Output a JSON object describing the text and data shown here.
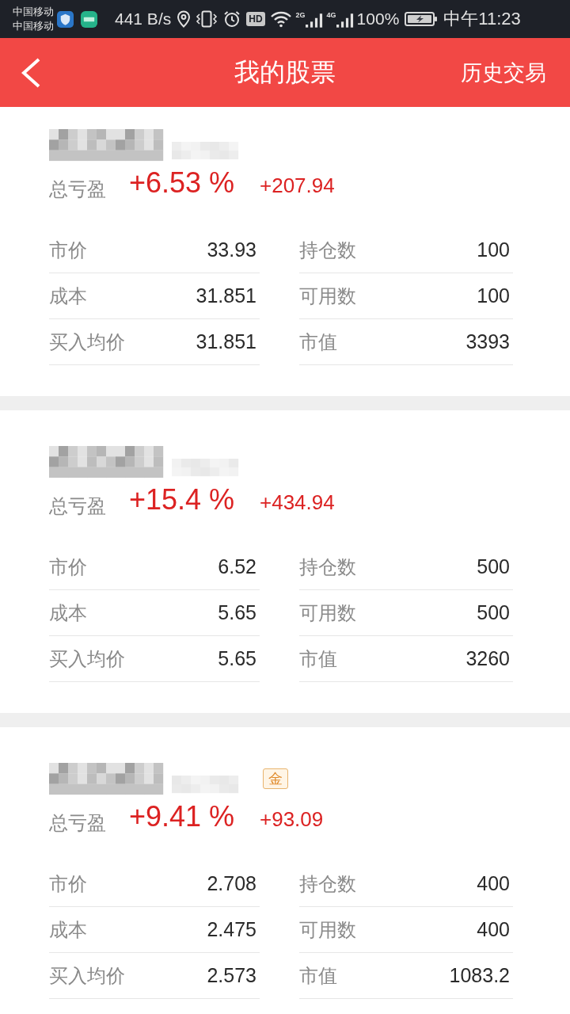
{
  "status_bar": {
    "carriers": [
      "中国移动",
      "中国移动"
    ],
    "net_speed": "441 B/s",
    "hd": "HD",
    "signals": [
      {
        "label": "2G"
      },
      {
        "label": "4G"
      }
    ],
    "battery": "100%",
    "time": "中午11:23"
  },
  "header": {
    "title": "我的股票",
    "action": "历史交易"
  },
  "stocks": [
    {
      "total_label": "总亏盈",
      "percent": "+6.53 %",
      "amount": "+207.94",
      "stats": [
        {
          "label": "市价",
          "value": "33.93"
        },
        {
          "label": "持仓数",
          "value": "100"
        },
        {
          "label": "成本",
          "value": "31.851"
        },
        {
          "label": "可用数",
          "value": "100"
        },
        {
          "label": "买入均价",
          "value": "31.851"
        },
        {
          "label": "市值",
          "value": "3393"
        }
      ]
    },
    {
      "total_label": "总亏盈",
      "percent": "+15.4 %",
      "amount": "+434.94",
      "stats": [
        {
          "label": "市价",
          "value": "6.52"
        },
        {
          "label": "持仓数",
          "value": "500"
        },
        {
          "label": "成本",
          "value": "5.65"
        },
        {
          "label": "可用数",
          "value": "500"
        },
        {
          "label": "买入均价",
          "value": "5.65"
        },
        {
          "label": "市值",
          "value": "3260"
        }
      ]
    },
    {
      "badge": "金",
      "total_label": "总亏盈",
      "percent": "+9.41 %",
      "amount": "+93.09",
      "stats": [
        {
          "label": "市价",
          "value": "2.708"
        },
        {
          "label": "持仓数",
          "value": "400"
        },
        {
          "label": "成本",
          "value": "2.475"
        },
        {
          "label": "可用数",
          "value": "400"
        },
        {
          "label": "买入均价",
          "value": "2.573"
        },
        {
          "label": "市值",
          "value": "1083.2"
        }
      ]
    }
  ]
}
